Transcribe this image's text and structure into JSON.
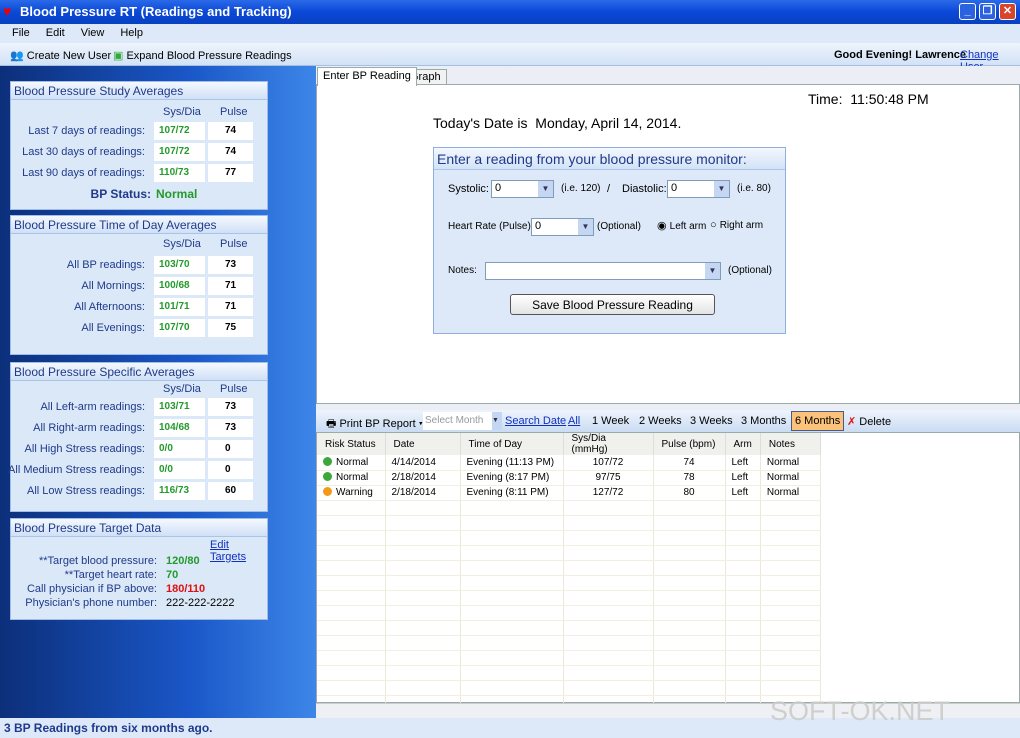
{
  "window": {
    "title": "Blood Pressure RT (Readings and Tracking)"
  },
  "menu": [
    "File",
    "Edit",
    "View",
    "Help"
  ],
  "toolbar": {
    "create_user": "Create New User",
    "expand": "Expand Blood Pressure Readings",
    "greeting": "Good Evening! Lawrence",
    "change_user": "Change User"
  },
  "study": {
    "title": "Blood Pressure Study Averages",
    "col1": "Sys/Dia",
    "col2": "Pulse",
    "rows": [
      {
        "label": "Last 7 days of readings:",
        "bp": "107/72",
        "pulse": "74"
      },
      {
        "label": "Last 30 days of readings:",
        "bp": "107/72",
        "pulse": "74"
      },
      {
        "label": "Last 90 days of readings:",
        "bp": "110/73",
        "pulse": "77"
      }
    ],
    "status_label": "BP Status:",
    "status": "Normal"
  },
  "tod": {
    "title": "Blood Pressure Time of Day Averages",
    "col1": "Sys/Dia",
    "col2": "Pulse",
    "rows": [
      {
        "label": "All BP readings:",
        "bp": "103/70",
        "pulse": "73"
      },
      {
        "label": "All Mornings:",
        "bp": "100/68",
        "pulse": "71"
      },
      {
        "label": "All Afternoons:",
        "bp": "101/71",
        "pulse": "71"
      },
      {
        "label": "All Evenings:",
        "bp": "107/70",
        "pulse": "75"
      }
    ]
  },
  "specific": {
    "title": "Blood Pressure Specific Averages",
    "col1": "Sys/Dia",
    "col2": "Pulse",
    "rows": [
      {
        "label": "All Left-arm readings:",
        "bp": "103/71",
        "pulse": "73"
      },
      {
        "label": "All Right-arm readings:",
        "bp": "104/68",
        "pulse": "73"
      },
      {
        "label": "All High Stress readings:",
        "bp": "0/0",
        "pulse": "0"
      },
      {
        "label": "All Medium Stress readings:",
        "bp": "0/0",
        "pulse": "0"
      },
      {
        "label": "All Low Stress readings:",
        "bp": "116/73",
        "pulse": "60"
      }
    ]
  },
  "target": {
    "title": "Blood Pressure Target Data",
    "edit": "Edit Targets",
    "rows": [
      {
        "label": "**Target blood pressure:",
        "value": "120/80"
      },
      {
        "label": "**Target heart rate:",
        "value": "70"
      },
      {
        "label": "Call physician if BP above:",
        "value": "180/110"
      },
      {
        "label": "Physician's phone number:",
        "value": "222-222-2222"
      }
    ]
  },
  "tabs": [
    "Enter BP Reading",
    "Graph"
  ],
  "main": {
    "time_label": "Time:",
    "time": "11:50:48 PM",
    "date_label": "Today's Date is",
    "date": "Monday, April 14, 2014."
  },
  "form": {
    "title": "Enter a reading from your blood pressure monitor:",
    "systolic_label": "Systolic:",
    "systolic": "0",
    "systolic_hint": "(i.e. 120)",
    "slash": "/",
    "diastolic_label": "Diastolic:",
    "diastolic": "0",
    "diastolic_hint": "(i.e. 80)",
    "hr_label": "Heart Rate (Pulse):",
    "hr": "0",
    "optional": "(Optional)",
    "left_arm": "Left arm",
    "right_arm": "Right arm",
    "notes_label": "Notes:",
    "notes": "",
    "save": "Save Blood Pressure Reading"
  },
  "gridbar": {
    "print": "Print BP Report",
    "month_placeholder": "Select Month",
    "search": "Search Date",
    "all": "All",
    "w1": "1 Week",
    "w2": "2 Weeks",
    "w3": "3 Weeks",
    "m3": "3 Months",
    "m6": "6 Months",
    "delete": "Delete"
  },
  "grid": {
    "columns": [
      "Risk Status",
      "Date",
      "Time of Day",
      "Sys/Dia (mmHg)",
      "Pulse (bpm)",
      "Arm",
      "Notes"
    ],
    "rows": [
      {
        "status": "Normal",
        "color": "#3aa83a",
        "date": "4/14/2014",
        "time": "Evening (11:13 PM)",
        "bp": "107/72",
        "pulse": "74",
        "arm": "Left",
        "notes": "Normal"
      },
      {
        "status": "Normal",
        "color": "#3aa83a",
        "date": "2/18/2014",
        "time": "Evening (8:17 PM)",
        "bp": "97/75",
        "pulse": "78",
        "arm": "Left",
        "notes": "Normal"
      },
      {
        "status": "Warning",
        "color": "#f39a1a",
        "date": "2/18/2014",
        "time": "Evening (8:11 PM)",
        "bp": "127/72",
        "pulse": "80",
        "arm": "Left",
        "notes": "Normal"
      }
    ]
  },
  "status": "3 BP Readings from six months ago.",
  "watermark": "SOFT-OK.NET"
}
